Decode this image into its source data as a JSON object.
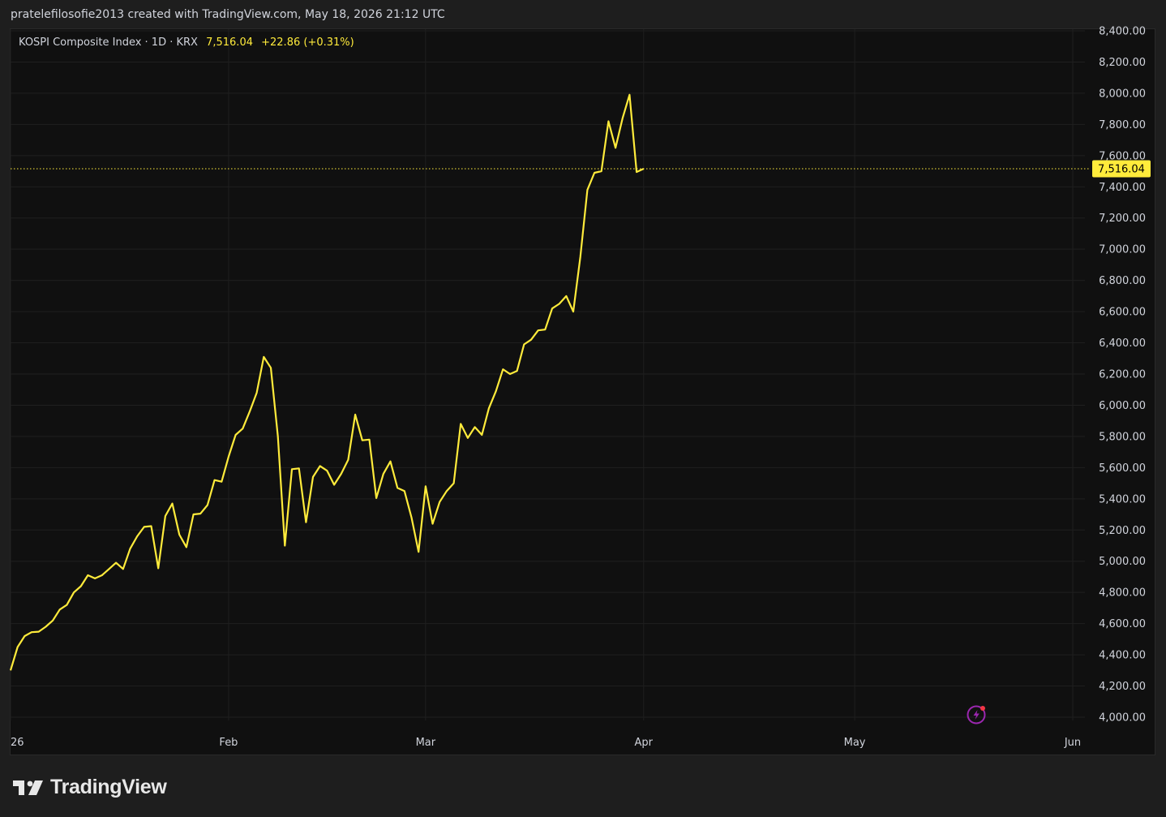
{
  "caption": "pratelefilosofie2013 created with TradingView.com, May 18, 2026 21:12 UTC",
  "legend": {
    "symbol": "KOSPI Composite Index · 1D · KRX",
    "last": "7,516.04",
    "change": "+22.86 (+0.31%)"
  },
  "brand": {
    "name": "TradingView"
  },
  "icons": {
    "logo": "tradingview-logo-icon",
    "bolt": "lightning-bolt-icon"
  },
  "colors": {
    "line": "#ffeb3b",
    "price_label_bg": "#ffeb3b",
    "grid": "#1f1f1f",
    "bolt": "#9c27b0",
    "bolt_dot": "#f23645"
  },
  "chart_data": {
    "type": "line",
    "title": "KOSPI Composite Index · 1D · KRX",
    "grid": true,
    "y_axis_position": "right",
    "ylim": [
      3960,
      8420
    ],
    "y_ticks": [
      {
        "value": 4000,
        "label": "4,000.00"
      },
      {
        "value": 4200,
        "label": "4,200.00"
      },
      {
        "value": 4400,
        "label": "4,400.00"
      },
      {
        "value": 4600,
        "label": "4,600.00"
      },
      {
        "value": 4800,
        "label": "4,800.00"
      },
      {
        "value": 5000,
        "label": "5,000.00"
      },
      {
        "value": 5200,
        "label": "5,200.00"
      },
      {
        "value": 5400,
        "label": "5,400.00"
      },
      {
        "value": 5600,
        "label": "5,600.00"
      },
      {
        "value": 5800,
        "label": "5,800.00"
      },
      {
        "value": 6000,
        "label": "6,000.00"
      },
      {
        "value": 6200,
        "label": "6,200.00"
      },
      {
        "value": 6400,
        "label": "6,400.00"
      },
      {
        "value": 6600,
        "label": "6,600.00"
      },
      {
        "value": 6800,
        "label": "6,800.00"
      },
      {
        "value": 7000,
        "label": "7,000.00"
      },
      {
        "value": 7200,
        "label": "7,200.00"
      },
      {
        "value": 7400,
        "label": "7,400.00"
      },
      {
        "value": 7600,
        "label": "7,600.00"
      },
      {
        "value": 7800,
        "label": "7,800.00"
      },
      {
        "value": 8000,
        "label": "8,000.00"
      },
      {
        "value": 8200,
        "label": "8,200.00"
      },
      {
        "value": 8400,
        "label": "8,400.00"
      }
    ],
    "x_ticks": [
      {
        "date": "2026-01-01",
        "label": "26"
      },
      {
        "date": "2026-02-01",
        "label": "Feb"
      },
      {
        "date": "2026-03-01",
        "label": "Mar"
      },
      {
        "date": "2026-04-01",
        "label": "Apr"
      },
      {
        "date": "2026-05-01",
        "label": "May"
      },
      {
        "date": "2026-06-01",
        "label": "Jun"
      }
    ],
    "xlim": [
      "2026-01-01",
      "2026-06-01"
    ],
    "last_price": {
      "value": 7516.04,
      "label": "7,516.04"
    },
    "series": [
      {
        "values": [
          {
            "x": "2026-01-01",
            "y": 4300
          },
          {
            "x": "2026-01-02",
            "y": 4450
          },
          {
            "x": "2026-01-03",
            "y": 4520
          },
          {
            "x": "2026-01-04",
            "y": 4545
          },
          {
            "x": "2026-01-05",
            "y": 4548
          },
          {
            "x": "2026-01-06",
            "y": 4580
          },
          {
            "x": "2026-01-07",
            "y": 4620
          },
          {
            "x": "2026-01-08",
            "y": 4690
          },
          {
            "x": "2026-01-09",
            "y": 4720
          },
          {
            "x": "2026-01-10",
            "y": 4800
          },
          {
            "x": "2026-01-11",
            "y": 4840
          },
          {
            "x": "2026-01-12",
            "y": 4910
          },
          {
            "x": "2026-01-13",
            "y": 4890
          },
          {
            "x": "2026-01-14",
            "y": 4910
          },
          {
            "x": "2026-01-15",
            "y": 4950
          },
          {
            "x": "2026-01-16",
            "y": 4990
          },
          {
            "x": "2026-01-17",
            "y": 4950
          },
          {
            "x": "2026-01-18",
            "y": 5080
          },
          {
            "x": "2026-01-19",
            "y": 5160
          },
          {
            "x": "2026-01-20",
            "y": 5220
          },
          {
            "x": "2026-01-21",
            "y": 5225
          },
          {
            "x": "2026-01-22",
            "y": 4955
          },
          {
            "x": "2026-01-23",
            "y": 5290
          },
          {
            "x": "2026-01-24",
            "y": 5370
          },
          {
            "x": "2026-01-25",
            "y": 5170
          },
          {
            "x": "2026-01-26",
            "y": 5090
          },
          {
            "x": "2026-01-27",
            "y": 5300
          },
          {
            "x": "2026-01-28",
            "y": 5305
          },
          {
            "x": "2026-01-29",
            "y": 5360
          },
          {
            "x": "2026-01-30",
            "y": 5520
          },
          {
            "x": "2026-01-31",
            "y": 5510
          },
          {
            "x": "2026-02-01",
            "y": 5670
          },
          {
            "x": "2026-02-02",
            "y": 5810
          },
          {
            "x": "2026-02-03",
            "y": 5850
          },
          {
            "x": "2026-02-04",
            "y": 5960
          },
          {
            "x": "2026-02-05",
            "y": 6080
          },
          {
            "x": "2026-02-06",
            "y": 6310
          },
          {
            "x": "2026-02-07",
            "y": 6240
          },
          {
            "x": "2026-02-08",
            "y": 5800
          },
          {
            "x": "2026-02-09",
            "y": 5100
          },
          {
            "x": "2026-02-10",
            "y": 5590
          },
          {
            "x": "2026-02-11",
            "y": 5595
          },
          {
            "x": "2026-02-12",
            "y": 5250
          },
          {
            "x": "2026-02-13",
            "y": 5540
          },
          {
            "x": "2026-02-14",
            "y": 5610
          },
          {
            "x": "2026-02-15",
            "y": 5580
          },
          {
            "x": "2026-02-16",
            "y": 5490
          },
          {
            "x": "2026-02-17",
            "y": 5560
          },
          {
            "x": "2026-02-18",
            "y": 5650
          },
          {
            "x": "2026-02-19",
            "y": 5940
          },
          {
            "x": "2026-02-20",
            "y": 5775
          },
          {
            "x": "2026-02-21",
            "y": 5780
          },
          {
            "x": "2026-02-22",
            "y": 5405
          },
          {
            "x": "2026-02-23",
            "y": 5560
          },
          {
            "x": "2026-02-24",
            "y": 5640
          },
          {
            "x": "2026-02-25",
            "y": 5470
          },
          {
            "x": "2026-02-26",
            "y": 5450
          },
          {
            "x": "2026-02-27",
            "y": 5280
          },
          {
            "x": "2026-02-28",
            "y": 5060
          },
          {
            "x": "2026-03-01",
            "y": 5480
          },
          {
            "x": "2026-03-02",
            "y": 5240
          },
          {
            "x": "2026-03-03",
            "y": 5380
          },
          {
            "x": "2026-03-04",
            "y": 5450
          },
          {
            "x": "2026-03-05",
            "y": 5500
          },
          {
            "x": "2026-03-06",
            "y": 5880
          },
          {
            "x": "2026-03-07",
            "y": 5790
          },
          {
            "x": "2026-03-08",
            "y": 5860
          },
          {
            "x": "2026-03-09",
            "y": 5810
          },
          {
            "x": "2026-03-10",
            "y": 5980
          },
          {
            "x": "2026-03-11",
            "y": 6090
          },
          {
            "x": "2026-03-12",
            "y": 6230
          },
          {
            "x": "2026-03-13",
            "y": 6200
          },
          {
            "x": "2026-03-14",
            "y": 6220
          },
          {
            "x": "2026-03-15",
            "y": 6390
          },
          {
            "x": "2026-03-16",
            "y": 6420
          },
          {
            "x": "2026-03-17",
            "y": 6480
          },
          {
            "x": "2026-03-18",
            "y": 6485
          },
          {
            "x": "2026-03-19",
            "y": 6620
          },
          {
            "x": "2026-03-20",
            "y": 6650
          },
          {
            "x": "2026-03-21",
            "y": 6700
          },
          {
            "x": "2026-03-22",
            "y": 6600
          },
          {
            "x": "2026-03-23",
            "y": 6950
          },
          {
            "x": "2026-03-24",
            "y": 7380
          },
          {
            "x": "2026-03-25",
            "y": 7490
          },
          {
            "x": "2026-03-26",
            "y": 7500
          },
          {
            "x": "2026-03-27",
            "y": 7820
          },
          {
            "x": "2026-03-28",
            "y": 7650
          },
          {
            "x": "2026-03-29",
            "y": 7840
          },
          {
            "x": "2026-03-30",
            "y": 7990
          },
          {
            "x": "2026-03-31",
            "y": 7495
          },
          {
            "x": "2026-04-01",
            "y": 7516.04
          }
        ]
      }
    ]
  }
}
